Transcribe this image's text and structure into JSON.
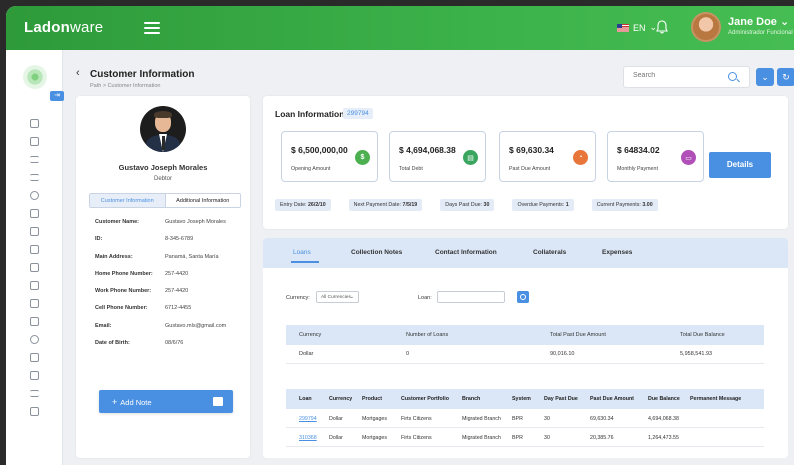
{
  "app": {
    "logo_a": "Ladon",
    "logo_b": "ware",
    "language": "EN",
    "user_name": "Jane Doe",
    "user_role": "Administrador Funcional"
  },
  "header": {
    "title": "Customer Information",
    "breadcrumb": "Path  >  Customer Information",
    "search_placeholder": "Search"
  },
  "profile": {
    "name": "Gustavo Joseph Morales",
    "role": "Debtor",
    "tabs": [
      "Customer Information",
      "Additional Information"
    ],
    "fields": [
      {
        "k": "Customer Name:",
        "v": "Gustavo Joseph Morales"
      },
      {
        "k": "ID:",
        "v": "8-345-6789"
      },
      {
        "k": "Main Address:",
        "v": "Panamá, Santa María"
      },
      {
        "k": "Home Phone Number:",
        "v": "257-4420"
      },
      {
        "k": "Work Phone Number:",
        "v": "257-4420"
      },
      {
        "k": "Cell Phone Number:",
        "v": "6712-4455"
      },
      {
        "k": "Email:",
        "v": "Gustavo.mls@gmail.com"
      },
      {
        "k": "Date of Birth:",
        "v": "08/6/76"
      }
    ],
    "add_note": "Add Note"
  },
  "loan_info": {
    "title": "Loan Information:",
    "loan_id": "299794",
    "stats": [
      {
        "amount": "$ 6,500,000,00",
        "label": "Opening Amount",
        "color": "#4caf50",
        "icon": "dollar-icon"
      },
      {
        "amount": "$ 4,694,068.38",
        "label": "Total Debt",
        "color": "#3aa55f",
        "icon": "document-icon"
      },
      {
        "amount": "$ 69,630.34",
        "label": "Past Due Amount",
        "color": "#e8763a",
        "icon": "pie-icon"
      },
      {
        "amount": "$ 64834.02",
        "label": "Monthly Payment",
        "color": "#b04fb8",
        "icon": "card-icon"
      }
    ],
    "details_label": "Details",
    "chips": [
      {
        "k": "Entry Date: ",
        "v": "26/2/10"
      },
      {
        "k": "Next Payment Date: ",
        "v": "7/5/19"
      },
      {
        "k": "Days Past Due: ",
        "v": "30"
      },
      {
        "k": "Overdue Payments: ",
        "v": "1"
      },
      {
        "k": "Current Payments: ",
        "v": "3.00"
      }
    ]
  },
  "loans_panel": {
    "tabs": [
      "Loans",
      "Collection Notes",
      "Contact Information",
      "Collaterals",
      "Expenses"
    ],
    "currency_label": "Currency:",
    "currency_value": "All Currencies",
    "loan_label": "Loan:",
    "summary": {
      "headers": [
        "Currency",
        "Number of Loans",
        "Total Past Due Amount",
        "Total Due Balance"
      ],
      "rows": [
        [
          "Dollar",
          "0",
          "90,016.10",
          "5,958,541.93"
        ]
      ]
    },
    "loans": {
      "headers": [
        "Loan",
        "Currency",
        "Product",
        "Customer Portfolio",
        "Branch",
        "System",
        "Day Past Due",
        "Past Due Amount",
        "Due Balance",
        "Permanent Message"
      ],
      "rows": [
        [
          "299794",
          "Dollar",
          "Mortgages",
          "Firts Citizens",
          "Migrated Branch",
          "BPR",
          "30",
          "69,630.34",
          "4,694,068.38",
          ""
        ],
        [
          "310368",
          "Dollar",
          "Mortgages",
          "Firts Citizens",
          "Migrated Branch",
          "BPR",
          "30",
          "20,385.76",
          "1,264,473.55",
          ""
        ]
      ]
    }
  }
}
